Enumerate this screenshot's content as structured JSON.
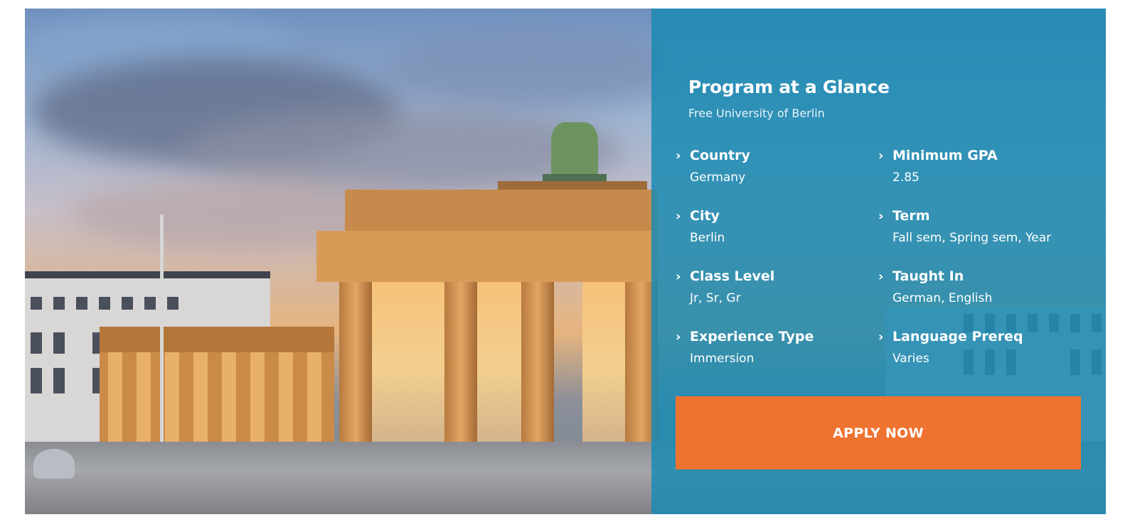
{
  "panel": {
    "title": "Program at a Glance",
    "subtitle": "Free University of Berlin",
    "chevron": "›",
    "items": [
      {
        "label": "Country",
        "value": "Germany"
      },
      {
        "label": "Minimum GPA",
        "value": "2.85"
      },
      {
        "label": "City",
        "value": "Berlin"
      },
      {
        "label": "Term",
        "value": "Fall sem, Spring sem, Year"
      },
      {
        "label": "Class Level",
        "value": "Jr, Sr, Gr"
      },
      {
        "label": "Taught In",
        "value": "German, English"
      },
      {
        "label": "Experience Type",
        "value": "Immersion"
      },
      {
        "label": "Language Prereq",
        "value": "Varies"
      }
    ],
    "apply_label": "APPLY NOW"
  },
  "colors": {
    "panel_overlay": "#1c8bb2",
    "button": "#ef7330",
    "text": "#ffffff"
  },
  "image": {
    "subject": "brandenburg-gate-photo"
  }
}
